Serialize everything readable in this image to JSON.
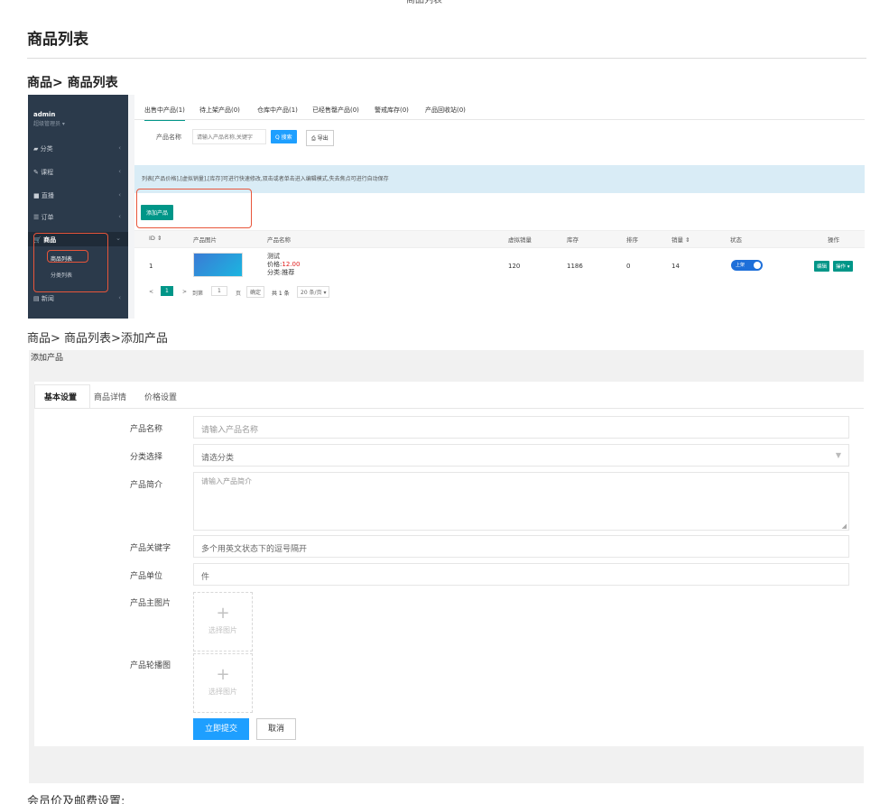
{
  "top_cut_text": "商品列表",
  "page_title": "商品列表",
  "breadcrumb1": "商品> 商品列表",
  "screenshot1": {
    "sidebar": {
      "user": "admin",
      "role": "超级管理员 ▾",
      "items": [
        {
          "label": "分类",
          "icon": "chart-icon"
        },
        {
          "label": "课程",
          "icon": "edit-icon"
        },
        {
          "label": "直播",
          "icon": "video-icon"
        },
        {
          "label": "订单",
          "icon": "list-icon"
        },
        {
          "label": "商品",
          "icon": "cart-icon"
        },
        {
          "label": "新闻",
          "icon": "news-icon"
        }
      ],
      "subitems": [
        "商品列表",
        "分类列表"
      ]
    },
    "tabs": [
      "出售中产品(1)",
      "待上架产品(0)",
      "仓库中产品(1)",
      "已经售罄产品(0)",
      "警戒库存(0)",
      "产品回收站(0)"
    ],
    "search": {
      "label": "产品名称",
      "placeholder": "请输入产品名称,关键字",
      "search_btn": "Q 搜索",
      "export_btn": "⎙ 导出"
    },
    "notice": "列表[产品价格],[虚拟销量],[库存]可进行快速修改,双击或者单击进入编辑模式,失去焦点可进行自动保存",
    "add_btn": "添加产品",
    "columns": [
      "ID ⇕",
      "产品图片",
      "产品名称",
      "虚拟销量",
      "库存",
      "排序",
      "销量 ⇕",
      "状态",
      "操作"
    ],
    "row": {
      "id": "1",
      "name": "测试",
      "price_label": "价格:",
      "price": "12.00",
      "category": "分类:推荐",
      "virtual_sales": "120",
      "stock": "1186",
      "sort": "0",
      "sales": "14",
      "status": "上架",
      "edit": "编辑",
      "ops": "操作 ▾"
    },
    "pager": {
      "prev": "<",
      "page": "1",
      "next": ">",
      "goto": "到第",
      "goto_val": "1",
      "page_unit": "页",
      "confirm": "确定",
      "total": "共 1 条",
      "per_page": "20 条/页 ▾"
    }
  },
  "breadcrumb2": "商品> 商品列表>添加产品",
  "form": {
    "panel_title": "添加产品",
    "tabs": [
      "基本设置",
      "商品详情",
      "价格设置"
    ],
    "fields": [
      {
        "label": "产品名称",
        "value": "请输入产品名称"
      },
      {
        "label": "分类选择",
        "value": "请选分类"
      },
      {
        "label": "产品简介",
        "value": "请输入产品简介"
      },
      {
        "label": "产品关键字",
        "value": "多个用英文状态下的逗号隔开"
      },
      {
        "label": "产品单位",
        "value": "件"
      }
    ],
    "upload_main_label": "产品主图片",
    "upload_carousel_label": "产品轮播图",
    "upload_text": "选择图片",
    "upload_plus": "+",
    "submit": "立即提交",
    "cancel": "取消"
  },
  "bottom_caption": "会员价及邮费设置:"
}
